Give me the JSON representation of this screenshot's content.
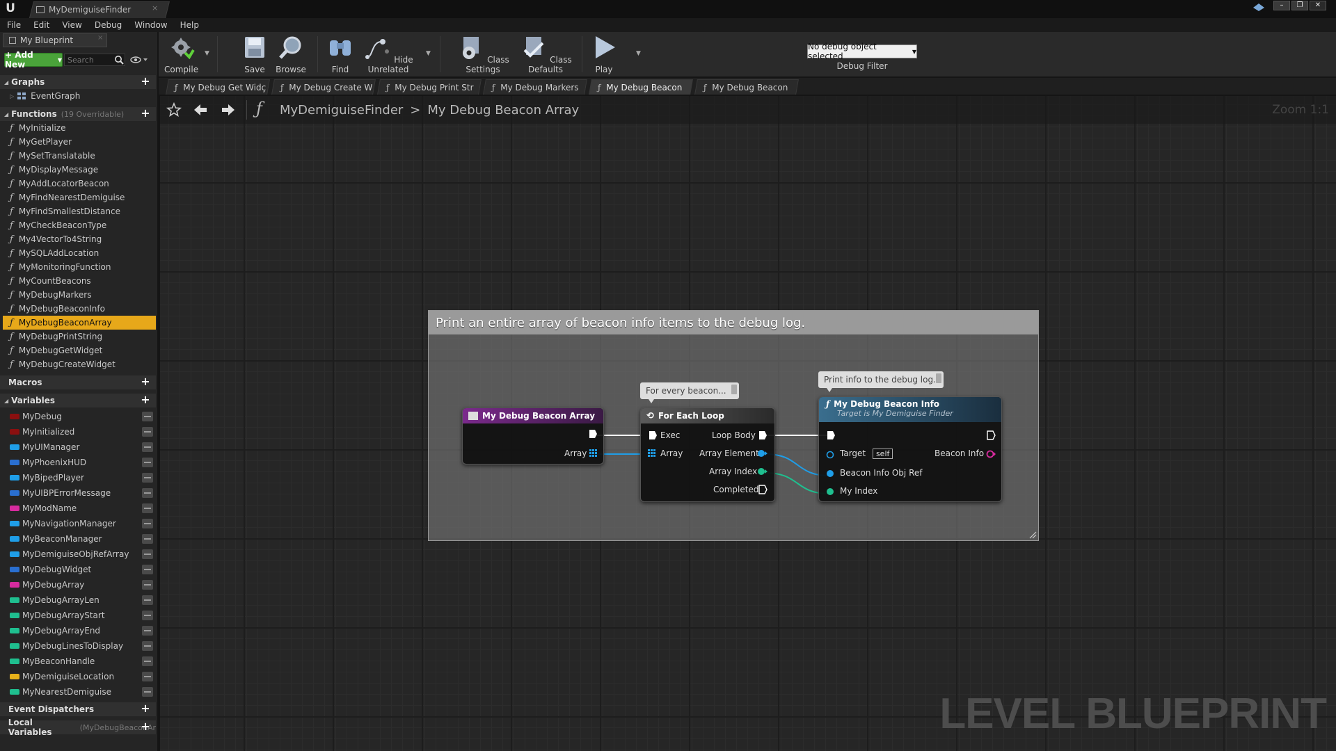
{
  "window": {
    "tab_title": "MyDemiguiseFinder",
    "close_glyph": "×",
    "buttons": {
      "minimize": "–",
      "maximize": "❐",
      "close": "✕"
    }
  },
  "menu": [
    "File",
    "Edit",
    "View",
    "Debug",
    "Window",
    "Help"
  ],
  "left_panel": {
    "tab_label": "My Blueprint",
    "add_new_label": "+ Add New",
    "search_placeholder": "Search",
    "graphs": {
      "header": "Graphs",
      "items": [
        "EventGraph"
      ]
    },
    "functions": {
      "header": "Functions",
      "subtext": "(19 Overridable)",
      "selected": "MyDebugBeaconArray",
      "items": [
        "MyInitialize",
        "MyGetPlayer",
        "MySetTranslatable",
        "MyDisplayMessage",
        "MyAddLocatorBeacon",
        "MyFindNearestDemiguise",
        "MyFindSmallestDistance",
        "MyCheckBeaconType",
        "My4VectorTo4String",
        "MySQLAddLocation",
        "MyMonitoringFunction",
        "MyCountBeacons",
        "MyDebugMarkers",
        "MyDebugBeaconInfo",
        "MyDebugBeaconArray",
        "MyDebugPrintString",
        "MyDebugGetWidget",
        "MyDebugCreateWidget"
      ]
    },
    "macros": {
      "header": "Macros"
    },
    "variables": {
      "header": "Variables",
      "items": [
        {
          "name": "MyDebug",
          "color": "#8b0f0f"
        },
        {
          "name": "MyInitialized",
          "color": "#8b0f0f"
        },
        {
          "name": "MyUIManager",
          "color": "#1f9ee8"
        },
        {
          "name": "MyPhoenixHUD",
          "color": "#2a6fd0"
        },
        {
          "name": "MyBipedPlayer",
          "color": "#1f9ee8"
        },
        {
          "name": "MyUIBPErrorMessage",
          "color": "#2a6fd0"
        },
        {
          "name": "MyModName",
          "color": "#d72b9e"
        },
        {
          "name": "MyNavigationManager",
          "color": "#1f9ee8"
        },
        {
          "name": "MyBeaconManager",
          "color": "#1f9ee8"
        },
        {
          "name": "MyDemiguiseObjRefArray",
          "color": "#1f9ee8"
        },
        {
          "name": "MyDebugWidget",
          "color": "#2a6fd0"
        },
        {
          "name": "MyDebugArray",
          "color": "#d72b9e"
        },
        {
          "name": "MyDebugArrayLen",
          "color": "#1fbf8f"
        },
        {
          "name": "MyDebugArrayStart",
          "color": "#1fbf8f"
        },
        {
          "name": "MyDebugArrayEnd",
          "color": "#1fbf8f"
        },
        {
          "name": "MyDebugLinesToDisplay",
          "color": "#1fbf8f"
        },
        {
          "name": "MyBeaconHandle",
          "color": "#1fbf8f"
        },
        {
          "name": "MyDemiguiseLocation",
          "color": "#e8b21a"
        },
        {
          "name": "MyNearestDemiguise",
          "color": "#1fbf8f"
        }
      ]
    },
    "event_dispatchers": {
      "header": "Event Dispatchers"
    },
    "local_variables": {
      "header": "Local Variables",
      "subtext": "(MyDebugBeaconAr"
    }
  },
  "toolbar": {
    "compile": "Compile",
    "save": "Save",
    "browse": "Browse",
    "find": "Find",
    "hide_unrelated": "Hide Unrelated",
    "class_settings": "Class Settings",
    "class_defaults": "Class Defaults",
    "play": "Play",
    "debug_select": "No debug object selected",
    "debug_filter": "Debug Filter"
  },
  "graph_tabs": [
    "My Debug Get Widç",
    "My Debug Create W",
    "My Debug Print Str",
    "My Debug Markers",
    "My Debug Beacon",
    "My Debug Beacon"
  ],
  "active_graph_tab": 4,
  "breadcrumb": {
    "root": "MyDemiguiseFinder",
    "sep": ">",
    "current": "My Debug Beacon Array"
  },
  "zoom": "Zoom 1:1",
  "watermark": "LEVEL BLUEPRINT",
  "comment": {
    "text": "Print an entire array of beacon info items to the debug log."
  },
  "nodes": {
    "entry": {
      "title": "My Debug Beacon Array",
      "pin_array": "Array"
    },
    "foreach": {
      "title": "For Each Loop",
      "bubble": "For every beacon...",
      "exec": "Exec",
      "loop_body": "Loop Body",
      "array": "Array",
      "array_element": "Array Element",
      "array_index": "Array Index",
      "completed": "Completed"
    },
    "info": {
      "title": "My Debug Beacon Info",
      "subtitle": "Target is My Demiguise Finder",
      "bubble": "Print info to the debug log.",
      "target": "Target",
      "self": "self",
      "beacon_info": "Beacon Info",
      "beacon_info_obj_ref": "Beacon Info Obj Ref",
      "my_index": "My Index"
    }
  }
}
